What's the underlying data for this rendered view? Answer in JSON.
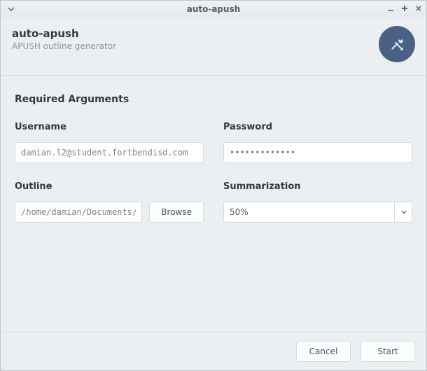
{
  "window": {
    "title": "auto-apush"
  },
  "header": {
    "app_name": "auto-apush",
    "subtitle": "APUSH outline generator"
  },
  "section": {
    "title": "Required Arguments"
  },
  "fields": {
    "username": {
      "label": "Username",
      "value": "damian.l2@student.fortbendisd.com"
    },
    "password": {
      "label": "Password",
      "value": "•••••••••••••"
    },
    "outline": {
      "label": "Outline",
      "value": "/home/damian/Documents/C",
      "browse_label": "Browse"
    },
    "summarization": {
      "label": "Summarization",
      "value": "50%"
    }
  },
  "footer": {
    "cancel": "Cancel",
    "start": "Start"
  }
}
